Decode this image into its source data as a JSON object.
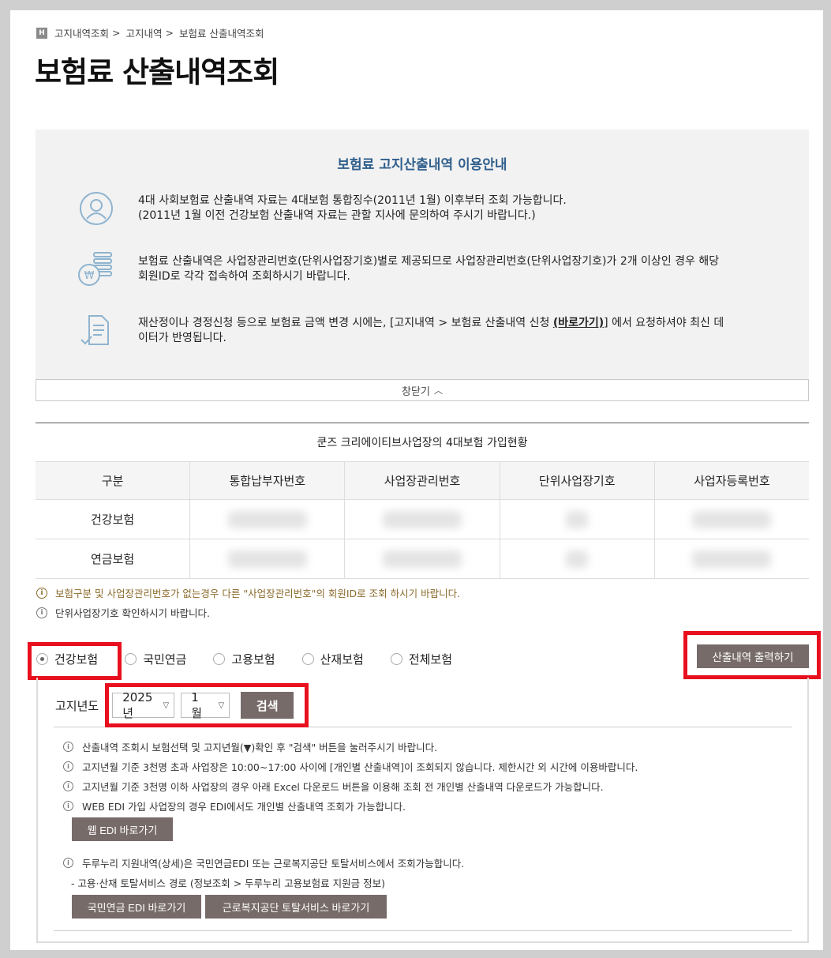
{
  "breadcrumb": {
    "home_icon": "H",
    "items": [
      "고지내역조회",
      "고지내역",
      "보험료 산출내역조회"
    ],
    "separator": ">"
  },
  "page_title": "보험료 산출내역조회",
  "info": {
    "title": "보험료 고지산출내역 이용안내",
    "items": [
      {
        "icon": "user-icon",
        "line1": "4대 사회보험료 산출내역 자료는 4대보험 통합징수(2011년 1월) 이후부터 조회 가능합니다.",
        "line2": "(2011년 1월 이전 건강보험 산출내역 자료는 관할 지사에 문의하여 주시기 바랍니다.)"
      },
      {
        "icon": "won-coins-icon",
        "line1": "보험료 산출내역은 사업장관리번호(단위사업장기호)별로 제공되므로 사업장관리번호(단위사업장기호)가 2개 이상인 경우 해당",
        "line2": "회원ID로 각각 접속하여 조회하시기 바랍니다."
      },
      {
        "icon": "document-check-icon",
        "line1_pre": "재산정이나 경정신청 등으로 보험료 금액 변경 시에는, [고지내역 > 보험료 산출내역 신청 ",
        "line1_link": "(바로가기)",
        "line1_post": "] 에서 요청하셔야 최신 데",
        "line2": "이터가 반영됩니다."
      }
    ],
    "close_label": "창닫기",
    "close_icon": "chevron-up-icon"
  },
  "table": {
    "caption": "쿤즈 크리에이티브사업장의 4대보험 가입현황",
    "headers": [
      "구분",
      "통합납부자번호",
      "사업장관리번호",
      "단위사업장기호",
      "사업자등록번호"
    ],
    "rows": [
      {
        "label": "건강보험"
      },
      {
        "label": "연금보험"
      }
    ]
  },
  "notes": {
    "warn": "보험구분 및 사업장관리번호가 없는경우 다른 \"사업장관리번호\"의 회원ID로 조회 하시기 바랍니다.",
    "info": "단위사업장기호 확인하시기 바랍니다.",
    "warn_color": "#8a6a2a"
  },
  "insurance_types": [
    "건강보험",
    "국민연금",
    "고용보험",
    "산재보험",
    "전체보험"
  ],
  "selected_type": "건강보험",
  "print_button": "산출내역 출력하기",
  "search": {
    "label": "고지년도",
    "year": "2025년",
    "month": "1월",
    "button": "검색"
  },
  "guides": [
    "산출내역 조회시 보험선택 및 고지년월(▼)확인 후 \"검색\" 버튼을 눌러주시기 바랍니다.",
    "고지년월 기준 3천명 초과 사업장은 10:00~17:00 사이에 [개인별 산출내역]이 조회되지 않습니다. 제한시간 외 시간에 이용바랍니다.",
    "고지년월 기준 3천명 이하 사업장의 경우 아래 Excel 다운로드 버튼을 이용해 조회 전 개인별 산출내역 다운로드가 가능합니다.",
    "WEB EDI 가입 사업장의 경우 EDI에서도 개인별 산출내역 조회가 가능합니다."
  ],
  "web_edi_button": "웹 EDI 바로가기",
  "support_note": "두루누리 지원내역(상세)은 국민연금EDI 또는 근로복지공단 토탈서비스에서 조회가능합니다.",
  "support_path": "- 고용·산재 토탈서비스 경로 (정보조회 > 두루누리 고용보험료 지원금 정보)",
  "pension_edi_button": "국민연금 EDI 바로가기",
  "comwel_button": "근로복지공단 토탈서비스 바로가기",
  "colors": {
    "accent_title": "#2f5f8c",
    "button_bg": "#776b69",
    "highlight": "#e8101e"
  }
}
